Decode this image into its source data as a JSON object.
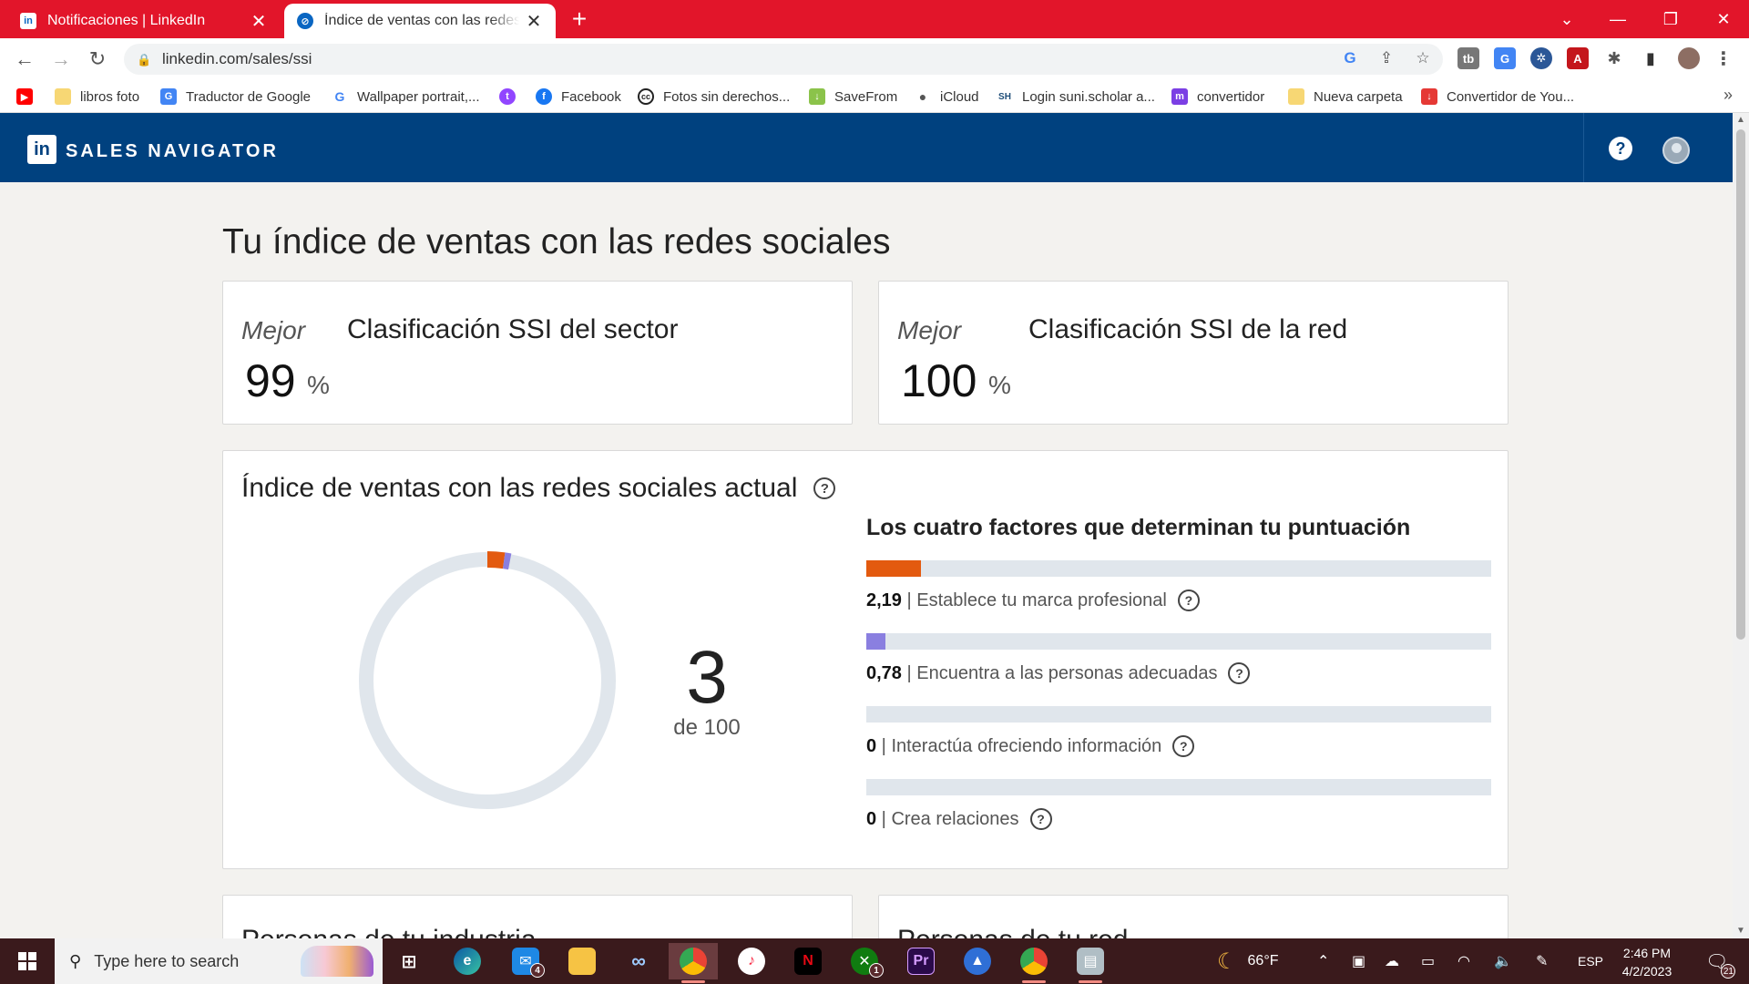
{
  "browser": {
    "tabs": [
      {
        "title": "Notificaciones | LinkedIn",
        "favicon": "in",
        "active": false
      },
      {
        "title": "Índice de ventas con las redes sociales",
        "favicon": "⊘",
        "active": true
      }
    ],
    "url": "linkedin.com/sales/ssi",
    "bookmarks": [
      {
        "label": "",
        "icon": "youtube-icon",
        "color": "#ff0000"
      },
      {
        "label": "libros foto",
        "icon": "folder-icon",
        "color": "#f7d774"
      },
      {
        "label": "Traductor de Google",
        "icon": "translate-icon",
        "color": "#4285f4"
      },
      {
        "label": "Wallpaper portrait,...",
        "icon": "google-icon",
        "color": "#fff"
      },
      {
        "label": "",
        "icon": "twitch-icon",
        "color": "#9146ff"
      },
      {
        "label": "Facebook",
        "icon": "facebook-icon",
        "color": "#1877f2"
      },
      {
        "label": "Fotos sin derechos...",
        "icon": "cc-icon",
        "color": "#222"
      },
      {
        "label": "SaveFrom",
        "icon": "download-arrow-icon",
        "color": "#8bc34a"
      },
      {
        "label": "iCloud",
        "icon": "apple-icon",
        "color": "#555"
      },
      {
        "label": "Login suni.scholar a...",
        "icon": "suni-icon",
        "color": "#1f4e79"
      },
      {
        "label": "convertidor",
        "icon": "m-icon",
        "color": "#7b3fe4"
      },
      {
        "label": "Nueva carpeta",
        "icon": "folder-icon",
        "color": "#f7d774"
      },
      {
        "label": "Convertidor de You...",
        "icon": "download-icon",
        "color": "#e53935"
      }
    ]
  },
  "header": {
    "logo_text": "in",
    "product": "SALES NAVIGATOR",
    "help": "?"
  },
  "main": {
    "title": "Tu índice de ventas con las redes sociales",
    "rank_cards": [
      {
        "best": "Mejor",
        "value": "99",
        "unit": "%",
        "title": "Clasificación SSI del sector"
      },
      {
        "best": "Mejor",
        "value": "100",
        "unit": "%",
        "title": "Clasificación SSI de la red"
      }
    ],
    "ssi": {
      "title": "Índice de ventas con las redes sociales actual",
      "score": "3",
      "of": "de 100",
      "score_value": 3,
      "factors_title": "Los cuatro factores que determinan tu puntuación",
      "factors": [
        {
          "value": "2,19",
          "label": "Establece tu marca profesional",
          "fraction": 0.0876,
          "color": "#e35a0f"
        },
        {
          "value": "0,78",
          "label": "Encuentra a las personas adecuadas",
          "fraction": 0.0312,
          "color": "#8a7fe0"
        },
        {
          "value": "0",
          "label": "Interactúa ofreciendo información",
          "fraction": 0,
          "color": "#5aa0d8"
        },
        {
          "value": "0",
          "label": "Crea relaciones",
          "fraction": 0,
          "color": "#2e8b57"
        }
      ]
    },
    "bottom_cards": [
      {
        "title": "Personas de tu industria"
      },
      {
        "title": "Personas de tu red"
      }
    ]
  },
  "taskbar": {
    "search_placeholder": "Type here to search",
    "weather": "66°F",
    "language": "ESP",
    "time": "2:46 PM",
    "date": "4/2/2023",
    "notifications": "21",
    "mail_badge": "4",
    "xbox_badge": "1",
    "apps": [
      "task-view-icon",
      "edge-icon",
      "mail-icon",
      "file-explorer-icon",
      "infinity-icon",
      "chrome-icon",
      "itunes-icon",
      "netflix-icon",
      "xbox-icon",
      "premiere-icon",
      "remote-icon",
      "chrome-icon",
      "stack-icon"
    ]
  }
}
